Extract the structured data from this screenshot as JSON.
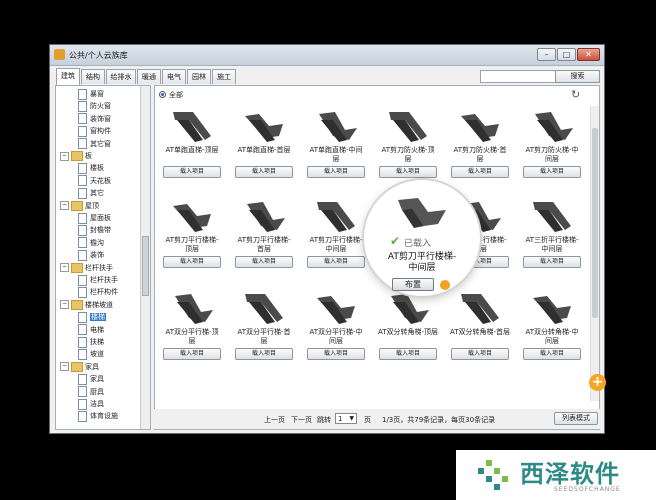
{
  "window": {
    "title": "公共/个人云族库"
  },
  "tabs": [
    {
      "label": "建筑",
      "active": true
    },
    {
      "label": "结构"
    },
    {
      "label": "给排水"
    },
    {
      "label": "暖通"
    },
    {
      "label": "电气"
    },
    {
      "label": "园林"
    },
    {
      "label": "施工"
    }
  ],
  "search": {
    "button_label": "搜索",
    "placeholder": ""
  },
  "tree": {
    "items": [
      {
        "label": "暴窗",
        "type": "doc",
        "level": 2
      },
      {
        "label": "防火窗",
        "type": "doc",
        "level": 2
      },
      {
        "label": "装饰窗",
        "type": "doc",
        "level": 2
      },
      {
        "label": "窗构件",
        "type": "doc",
        "level": 2
      },
      {
        "label": "其它窗",
        "type": "doc",
        "level": 2
      },
      {
        "label": "板",
        "type": "folder",
        "level": 1
      },
      {
        "label": "楼板",
        "type": "doc",
        "level": 2
      },
      {
        "label": "天花板",
        "type": "doc",
        "level": 2
      },
      {
        "label": "其它",
        "type": "doc",
        "level": 2
      },
      {
        "label": "屋顶",
        "type": "folder",
        "level": 1
      },
      {
        "label": "屋面板",
        "type": "doc",
        "level": 2
      },
      {
        "label": "封檐带",
        "type": "doc",
        "level": 2
      },
      {
        "label": "檐沟",
        "type": "doc",
        "level": 2
      },
      {
        "label": "装饰",
        "type": "doc",
        "level": 2
      },
      {
        "label": "栏杆扶手",
        "type": "folder",
        "level": 1
      },
      {
        "label": "栏杆扶手",
        "type": "doc",
        "level": 2
      },
      {
        "label": "栏杆构件",
        "type": "doc",
        "level": 2
      },
      {
        "label": "楼梯坡道",
        "type": "folder",
        "level": 1
      },
      {
        "label": "楼梯",
        "type": "doc",
        "level": 2,
        "selected": true
      },
      {
        "label": "电梯",
        "type": "doc",
        "level": 2
      },
      {
        "label": "扶梯",
        "type": "doc",
        "level": 2
      },
      {
        "label": "坡道",
        "type": "doc",
        "level": 2
      },
      {
        "label": "家具",
        "type": "folder",
        "level": 1
      },
      {
        "label": "家具",
        "type": "doc",
        "level": 2
      },
      {
        "label": "厨具",
        "type": "doc",
        "level": 2
      },
      {
        "label": "洁具",
        "type": "doc",
        "level": 2
      },
      {
        "label": "体育设施",
        "type": "doc",
        "level": 2
      }
    ]
  },
  "filter": {
    "all_label": "全部"
  },
  "load_label": "载入项目",
  "items": [
    {
      "name": "AT单跑直梯-顶层"
    },
    {
      "name": "AT单跑直梯-首层"
    },
    {
      "name": "AT单跑直梯-中间\n层"
    },
    {
      "name": "AT剪刀防火梯-顶\n层"
    },
    {
      "name": "AT剪刀防火梯-首\n层"
    },
    {
      "name": "AT剪刀防火梯-中\n间层"
    },
    {
      "name": "AT剪刀平行楼梯-\n顶层"
    },
    {
      "name": "AT剪刀平行楼梯-\n首层"
    },
    {
      "name": "AT剪刀平行楼梯-\n中间层"
    },
    {
      "name": "AT剪刀平行楼梯-\n中间层"
    },
    {
      "name": "AT三折平行楼梯-\n首层"
    },
    {
      "name": "AT三折平行楼梯-\n中间层"
    },
    {
      "name": "AT双分平行梯-顶\n层"
    },
    {
      "name": "AT双分平行梯-首\n层"
    },
    {
      "name": "AT双分平行梯-中\n间层"
    },
    {
      "name": "AT双分转角梯-顶层"
    },
    {
      "name": "AT双分转角梯-首层"
    },
    {
      "name": "AT双分转角梯-中\n间层"
    }
  ],
  "spotlight": {
    "status": "已载入",
    "title": "AT剪刀平行楼梯-\n中间层",
    "button_label": "布置"
  },
  "pager": {
    "prev": "上一页",
    "next": "下一页",
    "jump": "跳转",
    "page": "1",
    "page_unit": "页",
    "summary": "1/3页，共79条记录，每页30条记录",
    "list_mode": "列表模式"
  },
  "watermark": {
    "title": "西泽软件",
    "subtitle": "SEEDSOFCHANGE"
  },
  "colors": {
    "accent": "#3a78c9",
    "watermark": "#2c8a87",
    "badge": "#f5a623"
  }
}
